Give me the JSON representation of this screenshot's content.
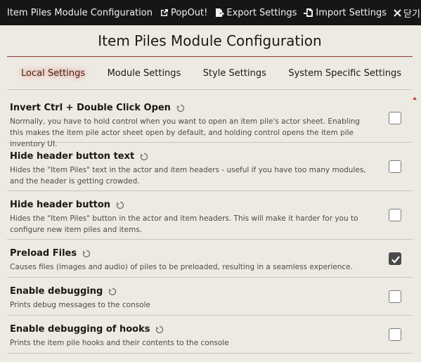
{
  "titlebar": {
    "title": "Item Piles Module Configuration",
    "popout_label": "PopOut!",
    "export_label": "Export Settings",
    "import_label": "Import Settings",
    "close_label": "닫기"
  },
  "heading": "Item Piles Module Configuration",
  "tabs": [
    {
      "label": "Local Settings",
      "active": true
    },
    {
      "label": "Module Settings",
      "active": false
    },
    {
      "label": "Style Settings",
      "active": false
    },
    {
      "label": "System Specific Settings",
      "active": false
    }
  ],
  "settings": [
    {
      "label": "Invert Ctrl + Double Click Open",
      "hint": "Normally, you have to hold control when you want to open an item pile's actor sheet. Enabling this makes the item pile actor sheet open by default, and holding control opens the item pile inventory UI.",
      "checked": false
    },
    {
      "label": "Hide header button text",
      "hint": "Hides the \"Item Piles\" text in the actor and item headers - useful if you have too many modules, and the header is getting crowded.",
      "checked": false
    },
    {
      "label": "Hide header button",
      "hint": "Hides the \"Item Piles\" button in the actor and item headers. This will make it harder for you to configure new item piles and items.",
      "checked": false
    },
    {
      "label": "Preload Files",
      "hint": "Causes files (images and audio) of piles to be preloaded, resulting in a seamless experience.",
      "checked": true
    },
    {
      "label": "Enable debugging",
      "hint": "Prints debug messages to the console",
      "checked": false
    },
    {
      "label": "Enable debugging of hooks",
      "hint": "Prints the item pile hooks and their contents to the console",
      "checked": false
    }
  ]
}
